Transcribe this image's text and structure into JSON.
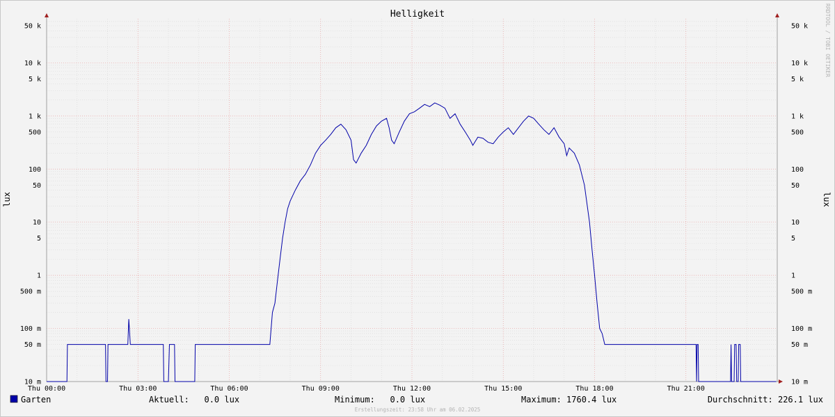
{
  "chart_data": {
    "type": "line",
    "title": "Helligkeit",
    "ylabel": "lux",
    "y_scale": "log",
    "ylim": [
      0.01,
      90000
    ],
    "y_ticks": [
      {
        "value": 50000,
        "label": "50 k"
      },
      {
        "value": 10000,
        "label": "10 k"
      },
      {
        "value": 5000,
        "label": "5 k"
      },
      {
        "value": 1000,
        "label": "1 k"
      },
      {
        "value": 500,
        "label": "500"
      },
      {
        "value": 100,
        "label": "100"
      },
      {
        "value": 50,
        "label": "50"
      },
      {
        "value": 10,
        "label": "10"
      },
      {
        "value": 5,
        "label": "5"
      },
      {
        "value": 1,
        "label": "1"
      },
      {
        "value": 0.5,
        "label": "500 m"
      },
      {
        "value": 0.1,
        "label": "100 m"
      },
      {
        "value": 0.05,
        "label": "50 m"
      },
      {
        "value": 0.01,
        "label": "10 m"
      }
    ],
    "x_ticks": [
      "Thu 00:00",
      "Thu 03:00",
      "Thu 06:00",
      "Thu 09:00",
      "Thu 12:00",
      "Thu 15:00",
      "Thu 18:00",
      "Thu 21:00"
    ],
    "grid": true,
    "series": [
      {
        "name": "Garten",
        "color": "#0000a8",
        "points": [
          [
            "00:00",
            0.01
          ],
          [
            "00:40",
            0.01
          ],
          [
            "00:41",
            0.05
          ],
          [
            "01:56",
            0.05
          ],
          [
            "01:57",
            0.01
          ],
          [
            "02:00",
            0.01
          ],
          [
            "02:01",
            0.05
          ],
          [
            "02:40",
            0.05
          ],
          [
            "02:42",
            0.15
          ],
          [
            "02:45",
            0.05
          ],
          [
            "03:50",
            0.05
          ],
          [
            "03:51",
            0.01
          ],
          [
            "04:00",
            0.01
          ],
          [
            "04:02",
            0.05
          ],
          [
            "04:12",
            0.05
          ],
          [
            "04:13",
            0.01
          ],
          [
            "04:52",
            0.01
          ],
          [
            "04:53",
            0.05
          ],
          [
            "07:20",
            0.05
          ],
          [
            "07:25",
            0.2
          ],
          [
            "07:30",
            0.3
          ],
          [
            "07:35",
            0.8
          ],
          [
            "07:40",
            2
          ],
          [
            "07:45",
            5
          ],
          [
            "07:50",
            10
          ],
          [
            "07:55",
            18
          ],
          [
            "08:00",
            25
          ],
          [
            "08:10",
            40
          ],
          [
            "08:20",
            60
          ],
          [
            "08:30",
            80
          ],
          [
            "08:40",
            120
          ],
          [
            "08:50",
            200
          ],
          [
            "09:00",
            280
          ],
          [
            "09:10",
            350
          ],
          [
            "09:20",
            450
          ],
          [
            "09:30",
            600
          ],
          [
            "09:40",
            700
          ],
          [
            "09:50",
            550
          ],
          [
            "10:00",
            350
          ],
          [
            "10:05",
            150
          ],
          [
            "10:10",
            130
          ],
          [
            "10:20",
            200
          ],
          [
            "10:30",
            280
          ],
          [
            "10:40",
            450
          ],
          [
            "10:50",
            650
          ],
          [
            "11:00",
            800
          ],
          [
            "11:10",
            900
          ],
          [
            "11:15",
            600
          ],
          [
            "11:20",
            350
          ],
          [
            "11:25",
            300
          ],
          [
            "11:35",
            500
          ],
          [
            "11:45",
            800
          ],
          [
            "11:55",
            1100
          ],
          [
            "12:05",
            1200
          ],
          [
            "12:15",
            1400
          ],
          [
            "12:25",
            1650
          ],
          [
            "12:35",
            1500
          ],
          [
            "12:45",
            1760.4
          ],
          [
            "12:55",
            1600
          ],
          [
            "13:05",
            1400
          ],
          [
            "13:15",
            900
          ],
          [
            "13:25",
            1100
          ],
          [
            "13:35",
            700
          ],
          [
            "13:45",
            500
          ],
          [
            "13:55",
            350
          ],
          [
            "14:00",
            280
          ],
          [
            "14:10",
            400
          ],
          [
            "14:20",
            380
          ],
          [
            "14:30",
            320
          ],
          [
            "14:40",
            300
          ],
          [
            "14:50",
            400
          ],
          [
            "15:00",
            500
          ],
          [
            "15:10",
            600
          ],
          [
            "15:20",
            450
          ],
          [
            "15:30",
            600
          ],
          [
            "15:40",
            800
          ],
          [
            "15:50",
            1000
          ],
          [
            "16:00",
            900
          ],
          [
            "16:10",
            700
          ],
          [
            "16:20",
            550
          ],
          [
            "16:30",
            450
          ],
          [
            "16:40",
            600
          ],
          [
            "16:50",
            400
          ],
          [
            "17:00",
            300
          ],
          [
            "17:05",
            180
          ],
          [
            "17:10",
            250
          ],
          [
            "17:20",
            200
          ],
          [
            "17:30",
            120
          ],
          [
            "17:40",
            50
          ],
          [
            "17:50",
            10
          ],
          [
            "17:55",
            3
          ],
          [
            "18:00",
            1
          ],
          [
            "18:05",
            0.3
          ],
          [
            "18:10",
            0.1
          ],
          [
            "18:15",
            0.08
          ],
          [
            "18:20",
            0.05
          ],
          [
            "21:20",
            0.05
          ],
          [
            "21:21",
            0.01
          ],
          [
            "21:22",
            0.05
          ],
          [
            "21:24",
            0.05
          ],
          [
            "21:25",
            0.01
          ],
          [
            "22:28",
            0.01
          ],
          [
            "22:29",
            0.05
          ],
          [
            "22:30",
            0.01
          ],
          [
            "22:35",
            0.01
          ],
          [
            "22:36",
            0.05
          ],
          [
            "22:39",
            0.05
          ],
          [
            "22:40",
            0.01
          ],
          [
            "22:43",
            0.01
          ],
          [
            "22:44",
            0.05
          ],
          [
            "22:47",
            0.05
          ],
          [
            "22:48",
            0.01
          ],
          [
            "23:58",
            0.01
          ]
        ]
      }
    ],
    "legend": {
      "series_name": "Garten",
      "current": "Aktuell:   0.0 lux",
      "minimum": "Minimum:   0.0 lux",
      "maximum": "Maximum: 1760.4 lux",
      "average": "Durchschnitt: 226.1 lux"
    },
    "footer": "Erstellungszeit: 23:58 Uhr am 06.02.2025",
    "watermark": "RRDTOOL / TOBI OETIKER",
    "colors": {
      "minor_grid": "#d8d8d8",
      "major_grid": "#e8a0a0",
      "axis": "#a0a0a0",
      "arrow": "#a02020",
      "series": "#0000a8"
    }
  }
}
